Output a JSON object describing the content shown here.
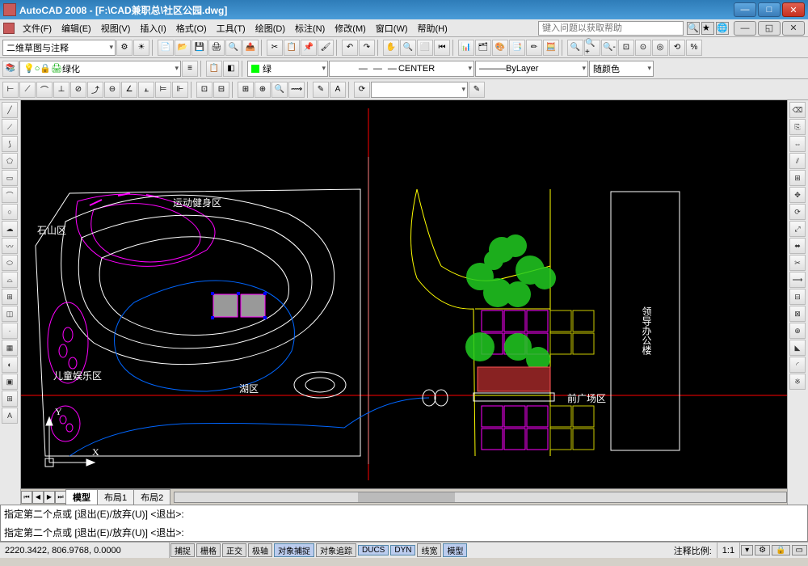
{
  "title": "AutoCAD 2008 - [F:\\CAD兼职总\\社区公园.dwg]",
  "help_placeholder": "键入问题以获取帮助",
  "menus": [
    "文件(F)",
    "编辑(E)",
    "视图(V)",
    "插入(I)",
    "格式(O)",
    "工具(T)",
    "绘图(D)",
    "标注(N)",
    "修改(M)",
    "窗口(W)",
    "帮助(H)"
  ],
  "workspace": "二维草图与注释",
  "layer_dd": "绿化",
  "color_dd": "绿",
  "linetype_dd": "CENTER",
  "lineweight_dd": "ByLayer",
  "plotstyle_dd": "随颜色",
  "tabs": {
    "active": "模型",
    "others": [
      "布局1",
      "布局2"
    ]
  },
  "labels": {
    "sport": "运动健身区",
    "hill": "石山区",
    "kids": "儿童娱乐区",
    "lake": "湖区",
    "plaza": "前广场区",
    "building": "领导办公楼",
    "yaxis": "Y",
    "xaxis": "X"
  },
  "cmd1": "指定第二个点或 [退出(E)/放弃(U)] <退出>:",
  "cmd2": "指定第二个点或 [退出(E)/放弃(U)] <退出>:",
  "coords": "2220.3422, 806.9768, 0.0000",
  "modes": [
    "捕捉",
    "栅格",
    "正交",
    "极轴",
    "对象捕捉",
    "对象追踪",
    "DUCS",
    "DYN",
    "线宽",
    "模型"
  ],
  "scale_label": "注释比例:",
  "scale_val": "1:1"
}
